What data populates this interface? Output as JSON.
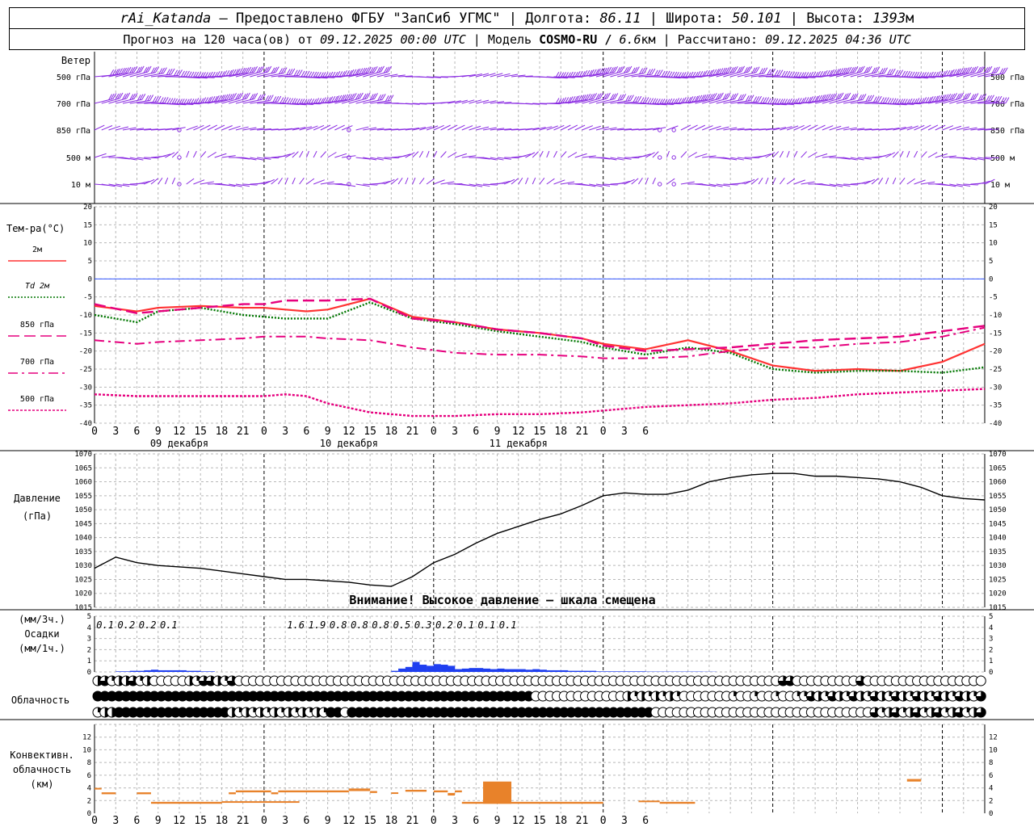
{
  "header": {
    "line1": {
      "station": "rAi_Katanda",
      "provider": " — Предоставлено ФГБУ \"ЗапСиб УГМС\" | Долгота: ",
      "lon": "86.11",
      "lat_label": " | Широта: ",
      "lat": "50.101",
      "alt_label": " | Высота: ",
      "alt": "1393",
      "alt_unit": "м"
    },
    "line2": {
      "prefix": "Прогноз на 120 часа(ов) от ",
      "from": "09.12.2025 00:00 UTC",
      "model_label": "  | Модель ",
      "model": "COSMO-RU / ",
      "res": "6.6",
      "res_unit": "км",
      "calc_label": " | Рассчитано: ",
      "calc": "09.12.2025 04:36 UTC"
    }
  },
  "colors": {
    "wind": "#8a2be2",
    "t2m": "#ff3333",
    "td2m": "#007700",
    "t850": "#e6007e",
    "t700": "#e6007e",
    "t500": "#e6007e",
    "zero_line": "#3355ff",
    "precip": "#1f3ff0",
    "convective": "#e8822a",
    "grid": "#b8b8b8"
  },
  "chart_data": [
    {
      "panel": "wind",
      "type": "wind_barbs",
      "title": "Ветер",
      "levels": [
        "500 гПа",
        "700 гПа",
        "850 гПа",
        "500 м",
        "10 м"
      ]
    },
    {
      "panel": "temperature",
      "type": "line",
      "ylabel": "Тем-ра(°C)",
      "ylim": [
        -40,
        20
      ],
      "yticks": [
        20,
        15,
        10,
        5,
        0,
        -5,
        -10,
        -15,
        -20,
        -25,
        -30,
        -35,
        -40
      ],
      "x_hours": [
        0,
        6,
        9,
        15,
        21,
        24,
        27,
        30,
        33,
        39,
        45,
        51,
        57,
        63,
        69,
        72,
        78,
        84,
        90,
        96,
        102,
        108,
        114,
        120,
        126
      ],
      "x_ticks": [
        "0",
        "3",
        "6",
        "9",
        "12",
        "15",
        "18",
        "21",
        "0",
        "3",
        "6",
        "9",
        "12",
        "15",
        "18",
        "21",
        "0",
        "3",
        "6",
        "9",
        "12",
        "15",
        "18",
        "21",
        "0",
        "3",
        "6"
      ],
      "day_labels": [
        "09 декабря",
        "10 декабря",
        "11 декабря"
      ],
      "series": [
        {
          "name": "2м",
          "values": [
            -7.5,
            -9,
            -8,
            -7.5,
            -8,
            -8,
            -8.5,
            -9,
            -8.5,
            -5.5,
            -10.5,
            -12,
            -14,
            -15,
            -16.5,
            -18,
            -19.5,
            -17,
            -20,
            -24,
            -25.5,
            -25,
            -25.5,
            -23,
            -18
          ]
        },
        {
          "name": "Td  2м",
          "values": [
            -10,
            -12,
            -9,
            -8,
            -10,
            -10.5,
            -11,
            -11,
            -11,
            -6.5,
            -11,
            -12.5,
            -14.5,
            -16,
            -17.5,
            -19,
            -21,
            -19,
            -20.5,
            -25,
            -26,
            -25.5,
            -25.5,
            -26,
            -24.5
          ]
        },
        {
          "name": "850 гПа",
          "values": [
            -7,
            -9.5,
            -9,
            -8,
            -7,
            -7,
            -6,
            -6,
            -6,
            -5.5,
            -11,
            -12,
            -14,
            -15,
            -16.5,
            -18.5,
            -20,
            -19.5,
            -19,
            -18,
            -17,
            -16.5,
            -16,
            -14.5,
            -13
          ]
        },
        {
          "name": "700 гПа",
          "values": [
            -17,
            -18,
            -17.5,
            -17,
            -16.5,
            -16,
            -16,
            -16,
            -16.5,
            -17,
            -19,
            -20.5,
            -21,
            -21,
            -21.5,
            -22,
            -22,
            -21.5,
            -20,
            -19,
            -19,
            -18,
            -17.5,
            -16,
            -13.5
          ]
        },
        {
          "name": "500 гПа",
          "values": [
            -32,
            -32.5,
            -32.5,
            -32.5,
            -32.5,
            -32.5,
            -32,
            -32.5,
            -34.5,
            -37,
            -38,
            -38,
            -37.5,
            -37.5,
            -37,
            -36.5,
            -35.5,
            -35,
            -34.5,
            -33.5,
            -33,
            -32,
            -31.5,
            -31,
            -30.5
          ]
        }
      ]
    },
    {
      "panel": "pressure",
      "type": "line",
      "ylabel": "Давление",
      "yunit": "(гПа)",
      "ylim": [
        1015,
        1070
      ],
      "yticks": [
        1070,
        1065,
        1060,
        1055,
        1050,
        1045,
        1040,
        1035,
        1030,
        1025,
        1020,
        1015
      ],
      "note": "Внимание! Высокое давление – шкала смещена",
      "x_hours": [
        0,
        3,
        6,
        9,
        12,
        15,
        18,
        21,
        24,
        27,
        30,
        33,
        36,
        39,
        42,
        45,
        48,
        51,
        54,
        57,
        60,
        63,
        66,
        69,
        72,
        75,
        78,
        81,
        84,
        87,
        90,
        93,
        96,
        99,
        102,
        105,
        108,
        111,
        114,
        117,
        120,
        123,
        126
      ],
      "values": [
        1029,
        1033,
        1031,
        1030,
        1029.5,
        1029,
        1028,
        1027,
        1026,
        1025,
        1025,
        1024.5,
        1024,
        1023,
        1022.5,
        1026,
        1031,
        1034,
        1038,
        1041.5,
        1044,
        1046.5,
        1048.5,
        1051.5,
        1055,
        1056,
        1055.5,
        1055.5,
        1057,
        1060,
        1061.5,
        1062.5,
        1063,
        1063,
        1062,
        1062,
        1061.5,
        1061,
        1060,
        1058,
        1055,
        1054,
        1053.5
      ]
    },
    {
      "panel": "precipitation",
      "type": "bar",
      "ylabel": [
        "(мм/3ч.)",
        "Осадки",
        "(мм/1ч.)"
      ],
      "ylim": [
        0,
        5
      ],
      "yticks": [
        5,
        4,
        3,
        2,
        1,
        0
      ],
      "sums_3h": [
        {
          "hour": 1.5,
          "label": "0.1"
        },
        {
          "hour": 4.5,
          "label": "0.2"
        },
        {
          "hour": 7.5,
          "label": "0.2"
        },
        {
          "hour": 10.5,
          "label": "0.1"
        },
        {
          "hour": 28.5,
          "label": "1.6"
        },
        {
          "hour": 31.5,
          "label": "1.9"
        },
        {
          "hour": 34.5,
          "label": "0.8"
        },
        {
          "hour": 37.5,
          "label": "0.8"
        },
        {
          "hour": 40.5,
          "label": "0.8"
        },
        {
          "hour": 43.5,
          "label": "0.5"
        },
        {
          "hour": 46.5,
          "label": "0.3"
        },
        {
          "hour": 49.5,
          "label": "0.2"
        },
        {
          "hour": 52.5,
          "label": "0.1"
        },
        {
          "hour": 55.5,
          "label": "0.1"
        },
        {
          "hour": 58.5,
          "label": "0.1"
        }
      ],
      "hourly": [
        0,
        0,
        0,
        0.05,
        0.05,
        0.1,
        0.1,
        0.15,
        0.2,
        0.15,
        0.15,
        0.15,
        0.15,
        0.1,
        0.1,
        0.05,
        0.05,
        0,
        0,
        0,
        0,
        0,
        0,
        0,
        0,
        0,
        0,
        0,
        0,
        0,
        0,
        0,
        0,
        0,
        0,
        0,
        0,
        0,
        0,
        0,
        0,
        0,
        0.1,
        0.3,
        0.45,
        0.9,
        0.65,
        0.55,
        0.7,
        0.65,
        0.55,
        0.25,
        0.3,
        0.35,
        0.35,
        0.3,
        0.25,
        0.3,
        0.25,
        0.25,
        0.25,
        0.2,
        0.25,
        0.2,
        0.15,
        0.15,
        0.15,
        0.1,
        0.1,
        0.1,
        0.1,
        0.05,
        0.05,
        0.05,
        0.05,
        0.05,
        0.05,
        0.05,
        0.03,
        0.03,
        0.03,
        0.03,
        0.03,
        0.03,
        0.03,
        0.03,
        0.02,
        0.02,
        0,
        0,
        0,
        0,
        0,
        0,
        0,
        0,
        0,
        0,
        0,
        0,
        0,
        0,
        0,
        0,
        0,
        0,
        0,
        0,
        0,
        0,
        0,
        0,
        0,
        0,
        0,
        0,
        0,
        0,
        0,
        0,
        0,
        0,
        0,
        0,
        0,
        0,
        0
      ]
    },
    {
      "panel": "cloudiness",
      "type": "table",
      "ylabel": "Облачность",
      "rows": [
        "high",
        "middle",
        "low"
      ]
    },
    {
      "panel": "convective",
      "type": "bar",
      "ylabel": [
        "Конвективн.",
        "облачность",
        "(км)"
      ],
      "ylim": [
        0,
        14
      ],
      "yticks": [
        12,
        10,
        8,
        6,
        4,
        2,
        0
      ],
      "x_ticks": [
        "0",
        "3",
        "6",
        "9",
        "12",
        "15",
        "18",
        "21",
        "0",
        "3",
        "6",
        "9",
        "12",
        "15",
        "18",
        "21",
        "0",
        "3",
        "6",
        "9",
        "12",
        "15",
        "18",
        "21",
        "0",
        "3",
        "6"
      ],
      "segments": [
        {
          "from": 0,
          "to": 1,
          "base": 3.8,
          "top": 4
        },
        {
          "from": 1,
          "to": 3,
          "base": 3,
          "top": 3.3
        },
        {
          "from": 6,
          "to": 8,
          "base": 3,
          "top": 3.3
        },
        {
          "from": 8,
          "to": 18,
          "base": 1.5,
          "top": 1.8
        },
        {
          "from": 18,
          "to": 29,
          "base": 1.7,
          "top": 1.9
        },
        {
          "from": 19,
          "to": 20,
          "base": 3,
          "top": 3.3
        },
        {
          "from": 20,
          "to": 25,
          "base": 3.3,
          "top": 3.6
        },
        {
          "from": 25,
          "to": 26,
          "base": 3,
          "top": 3.3
        },
        {
          "from": 26,
          "to": 36,
          "base": 3.3,
          "top": 3.6
        },
        {
          "from": 36,
          "to": 39,
          "base": 3.5,
          "top": 3.9
        },
        {
          "from": 39,
          "to": 40,
          "base": 3.2,
          "top": 3.5
        },
        {
          "from": 42,
          "to": 43,
          "base": 3.1,
          "top": 3.3
        },
        {
          "from": 44,
          "to": 47,
          "base": 3.4,
          "top": 3.7
        },
        {
          "from": 48,
          "to": 50,
          "base": 3.3,
          "top": 3.6
        },
        {
          "from": 50,
          "to": 51,
          "base": 2.8,
          "top": 3.2
        },
        {
          "from": 51,
          "to": 52,
          "base": 3.3,
          "top": 3.6
        },
        {
          "from": 55,
          "to": 59,
          "base": 1.5,
          "top": 5
        },
        {
          "from": 52,
          "to": 72,
          "base": 1.5,
          "top": 1.8
        },
        {
          "from": 80,
          "to": 85,
          "base": 1.5,
          "top": 1.8
        },
        {
          "from": 77,
          "to": 80,
          "base": 1.8,
          "top": 2
        },
        {
          "from": 115,
          "to": 117,
          "base": 5,
          "top": 5.4
        }
      ]
    }
  ]
}
